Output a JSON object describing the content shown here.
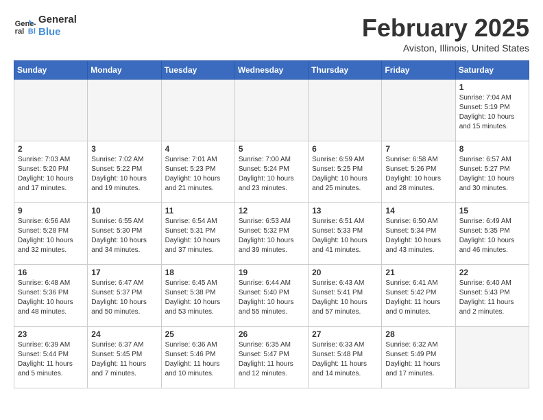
{
  "header": {
    "logo_line1": "General",
    "logo_line2": "Blue",
    "title": "February 2025",
    "subtitle": "Aviston, Illinois, United States"
  },
  "days_of_week": [
    "Sunday",
    "Monday",
    "Tuesday",
    "Wednesday",
    "Thursday",
    "Friday",
    "Saturday"
  ],
  "weeks": [
    [
      {
        "day": "",
        "info": ""
      },
      {
        "day": "",
        "info": ""
      },
      {
        "day": "",
        "info": ""
      },
      {
        "day": "",
        "info": ""
      },
      {
        "day": "",
        "info": ""
      },
      {
        "day": "",
        "info": ""
      },
      {
        "day": "1",
        "info": "Sunrise: 7:04 AM\nSunset: 5:19 PM\nDaylight: 10 hours\nand 15 minutes."
      }
    ],
    [
      {
        "day": "2",
        "info": "Sunrise: 7:03 AM\nSunset: 5:20 PM\nDaylight: 10 hours\nand 17 minutes."
      },
      {
        "day": "3",
        "info": "Sunrise: 7:02 AM\nSunset: 5:22 PM\nDaylight: 10 hours\nand 19 minutes."
      },
      {
        "day": "4",
        "info": "Sunrise: 7:01 AM\nSunset: 5:23 PM\nDaylight: 10 hours\nand 21 minutes."
      },
      {
        "day": "5",
        "info": "Sunrise: 7:00 AM\nSunset: 5:24 PM\nDaylight: 10 hours\nand 23 minutes."
      },
      {
        "day": "6",
        "info": "Sunrise: 6:59 AM\nSunset: 5:25 PM\nDaylight: 10 hours\nand 25 minutes."
      },
      {
        "day": "7",
        "info": "Sunrise: 6:58 AM\nSunset: 5:26 PM\nDaylight: 10 hours\nand 28 minutes."
      },
      {
        "day": "8",
        "info": "Sunrise: 6:57 AM\nSunset: 5:27 PM\nDaylight: 10 hours\nand 30 minutes."
      }
    ],
    [
      {
        "day": "9",
        "info": "Sunrise: 6:56 AM\nSunset: 5:28 PM\nDaylight: 10 hours\nand 32 minutes."
      },
      {
        "day": "10",
        "info": "Sunrise: 6:55 AM\nSunset: 5:30 PM\nDaylight: 10 hours\nand 34 minutes."
      },
      {
        "day": "11",
        "info": "Sunrise: 6:54 AM\nSunset: 5:31 PM\nDaylight: 10 hours\nand 37 minutes."
      },
      {
        "day": "12",
        "info": "Sunrise: 6:53 AM\nSunset: 5:32 PM\nDaylight: 10 hours\nand 39 minutes."
      },
      {
        "day": "13",
        "info": "Sunrise: 6:51 AM\nSunset: 5:33 PM\nDaylight: 10 hours\nand 41 minutes."
      },
      {
        "day": "14",
        "info": "Sunrise: 6:50 AM\nSunset: 5:34 PM\nDaylight: 10 hours\nand 43 minutes."
      },
      {
        "day": "15",
        "info": "Sunrise: 6:49 AM\nSunset: 5:35 PM\nDaylight: 10 hours\nand 46 minutes."
      }
    ],
    [
      {
        "day": "16",
        "info": "Sunrise: 6:48 AM\nSunset: 5:36 PM\nDaylight: 10 hours\nand 48 minutes."
      },
      {
        "day": "17",
        "info": "Sunrise: 6:47 AM\nSunset: 5:37 PM\nDaylight: 10 hours\nand 50 minutes."
      },
      {
        "day": "18",
        "info": "Sunrise: 6:45 AM\nSunset: 5:38 PM\nDaylight: 10 hours\nand 53 minutes."
      },
      {
        "day": "19",
        "info": "Sunrise: 6:44 AM\nSunset: 5:40 PM\nDaylight: 10 hours\nand 55 minutes."
      },
      {
        "day": "20",
        "info": "Sunrise: 6:43 AM\nSunset: 5:41 PM\nDaylight: 10 hours\nand 57 minutes."
      },
      {
        "day": "21",
        "info": "Sunrise: 6:41 AM\nSunset: 5:42 PM\nDaylight: 11 hours\nand 0 minutes."
      },
      {
        "day": "22",
        "info": "Sunrise: 6:40 AM\nSunset: 5:43 PM\nDaylight: 11 hours\nand 2 minutes."
      }
    ],
    [
      {
        "day": "23",
        "info": "Sunrise: 6:39 AM\nSunset: 5:44 PM\nDaylight: 11 hours\nand 5 minutes."
      },
      {
        "day": "24",
        "info": "Sunrise: 6:37 AM\nSunset: 5:45 PM\nDaylight: 11 hours\nand 7 minutes."
      },
      {
        "day": "25",
        "info": "Sunrise: 6:36 AM\nSunset: 5:46 PM\nDaylight: 11 hours\nand 10 minutes."
      },
      {
        "day": "26",
        "info": "Sunrise: 6:35 AM\nSunset: 5:47 PM\nDaylight: 11 hours\nand 12 minutes."
      },
      {
        "day": "27",
        "info": "Sunrise: 6:33 AM\nSunset: 5:48 PM\nDaylight: 11 hours\nand 14 minutes."
      },
      {
        "day": "28",
        "info": "Sunrise: 6:32 AM\nSunset: 5:49 PM\nDaylight: 11 hours\nand 17 minutes."
      },
      {
        "day": "",
        "info": ""
      }
    ]
  ]
}
